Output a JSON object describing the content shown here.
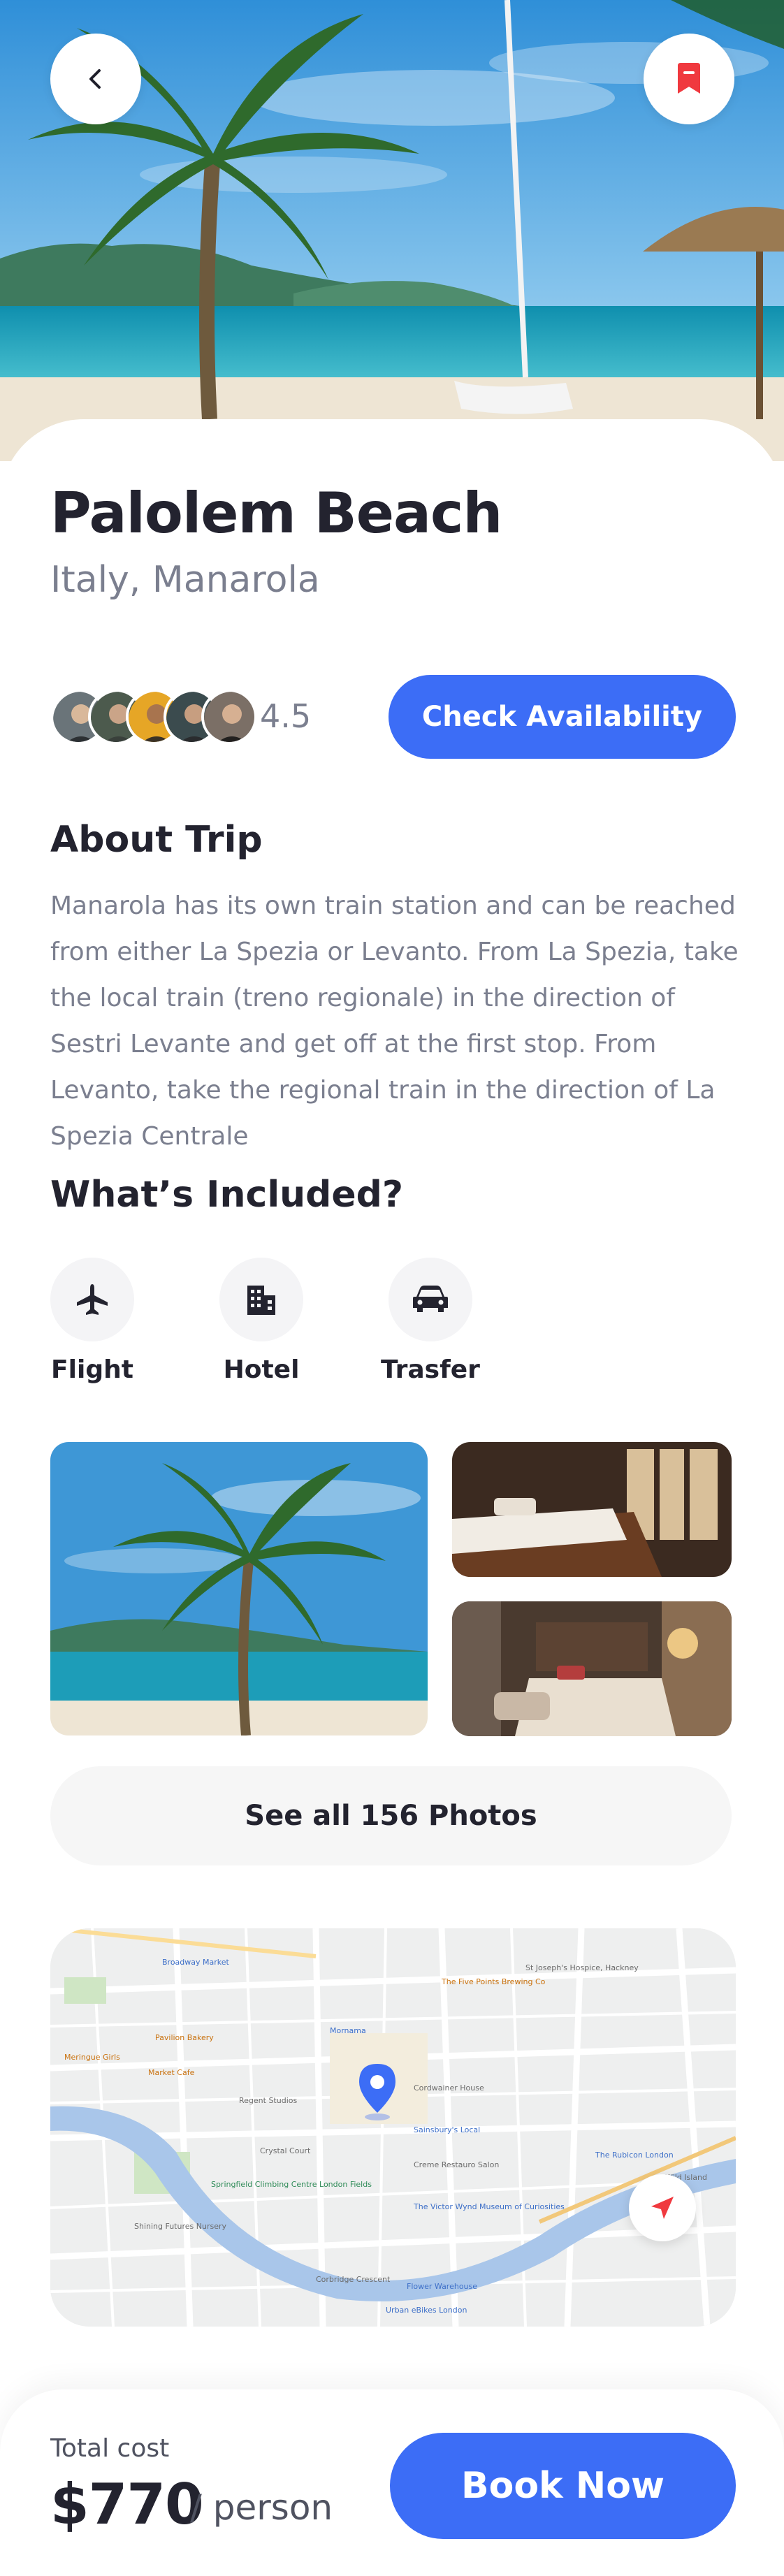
{
  "header": {
    "back_icon": "chevron-left-icon",
    "bookmark_icon": "bookmark-icon",
    "bookmark_color": "#f0393f"
  },
  "place": {
    "name": "Palolem Beach",
    "location": "Italy, Manarola",
    "rating": "4.5"
  },
  "actions": {
    "check_availability": "Check Availability",
    "see_all_photos": "See all 156 Photos",
    "book_now": "Book Now"
  },
  "about": {
    "title": "About Trip",
    "text": "Manarola has its own train station and can be reached from either La Spezia or Levanto. From La Spezia, take the local train (treno regionale) in the direction of Sestri Levante and get off at the first stop. From Levanto, take the regional train in the direction of La Spezia Centrale"
  },
  "included": {
    "title": "What’s Included?",
    "items": [
      {
        "label": "Flight",
        "icon": "airplane-icon"
      },
      {
        "label": "Hotel",
        "icon": "building-icon"
      },
      {
        "label": "Trasfer",
        "icon": "car-icon"
      }
    ]
  },
  "map": {
    "labels": [
      "Broadway Market",
      "The Five Points Brewing Co",
      "St Joseph's Hospice, Hackney",
      "Pavilion Bakery",
      "Mornama",
      "Meringue Girls",
      "Market Cafe",
      "Regent Studios",
      "Cordwainer House",
      "Sainsbury's Local",
      "Crystal Court",
      "Creme Restauro Salon",
      "Springfield Climbing Centre London Fields",
      "The Victor Wynd Museum of Curiosities",
      "Shining Futures Nursery",
      "Flower Warehouse",
      "Urban eBikes London",
      "Corbridge Crescent",
      "The Rubicon London",
      "Wild Island"
    ],
    "pin_color": "#3c6df6"
  },
  "footer": {
    "total_label": "Total cost",
    "price": "$770",
    "per": "/ person"
  },
  "colors": {
    "accent": "#3c6df6",
    "text_primary": "#23232f",
    "text_secondary": "#7b7f8f"
  }
}
